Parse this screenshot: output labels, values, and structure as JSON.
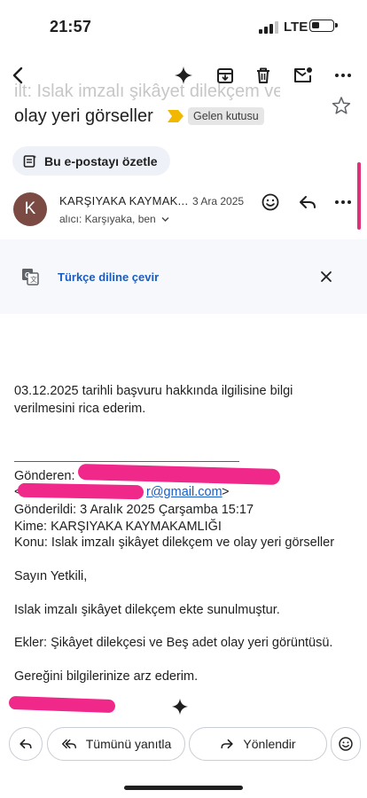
{
  "status_bar": {
    "time": "21:57",
    "network": "LTE",
    "signal_icon": "signal-bars-icon",
    "battery_icon": "battery-icon"
  },
  "toolbar": {
    "icons": [
      "back-arrow-icon",
      "gemini-sparkle-icon",
      "archive-icon",
      "trash-icon",
      "mark-unread-icon",
      "more-vert-icon"
    ]
  },
  "email": {
    "subject_faded": "ilt: Islak imzalı şikâyet dilekçem ve",
    "subject_line": "olay yeri görseller",
    "label": "Gelen kutusu",
    "summarize_label": "Bu e-postayı özetle",
    "sender_initial": "K",
    "sender_name": "KARŞIYAKA KAYMAK...",
    "date": "3 Ara 2025",
    "recipients": "alıcı: Karşıyaka, ben",
    "translate_label": "Türkçe diline çevir",
    "body": {
      "line1": "03.12.2025 tarihli başvuru hakkında ilgilisine bilgi",
      "line2": "verilmesini rica ederim.",
      "from_label": "Gönderen:",
      "from_email_open": "<",
      "from_email": "r@gmail.com",
      "from_email_close": ">",
      "sent": "Gönderildi: 3 Aralık 2025 Çarşamba 15:17",
      "to": "Kime: KARŞIYAKA KAYMAKAMLIĞI",
      "subject": "Konu: Islak imzalı şikâyet dilekçem ve olay yeri görseller",
      "greeting": "Sayın Yetkili,",
      "para1": "Islak imzalı şikâyet dilekçem ekte sunulmuştur.",
      "para2": "Ekler: Şikâyet dilekçesi ve Beş adet olay yeri görüntüsü.",
      "para3": "Gereğini bilgilerinize arz ederim."
    }
  },
  "actions": {
    "reply_all_label": "Tümünü yanıtla",
    "forward_label": "Yönlendir"
  },
  "colors": {
    "accent_blue": "#1a5dc2",
    "redaction_pink": "#f0288a",
    "avatar_brown": "#7b4a43",
    "label_yellow": "#f2b800"
  }
}
